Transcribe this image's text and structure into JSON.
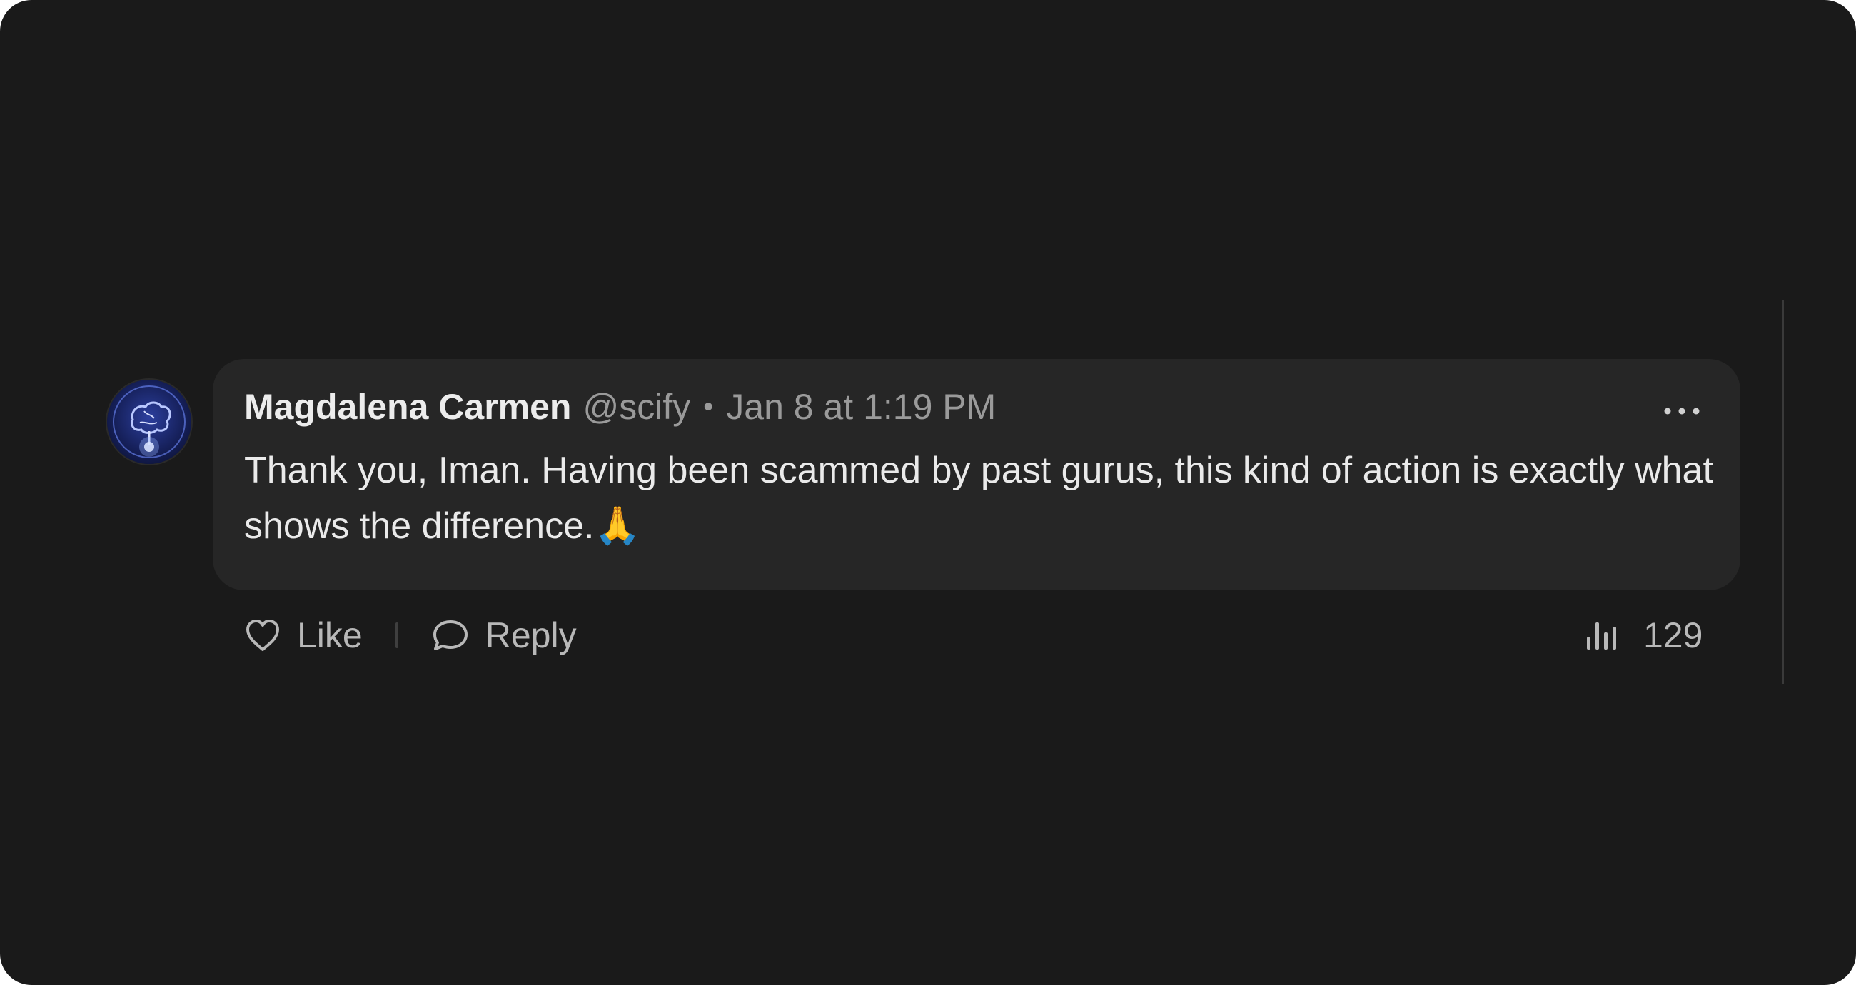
{
  "comment": {
    "author": "Magdalena Carmen",
    "handle": "@scify",
    "separator": "•",
    "timestamp": "Jan 8 at 1:19 PM",
    "text": "Thank you, Iman. Having been scammed by past gurus, this kind of action is exactly what shows the difference.🙏",
    "avatar_icon": "brain-avatar-icon"
  },
  "actions": {
    "like_label": "Like",
    "reply_label": "Reply",
    "views_count": "129",
    "more_icon": "ellipsis-icon",
    "like_icon": "heart-icon",
    "reply_icon": "speech-bubble-icon",
    "views_icon": "bar-chart-icon"
  },
  "colors": {
    "background": "#1a1a1a",
    "bubble": "#262626",
    "author_text": "#ececec",
    "muted_text": "#9a9a9a"
  }
}
